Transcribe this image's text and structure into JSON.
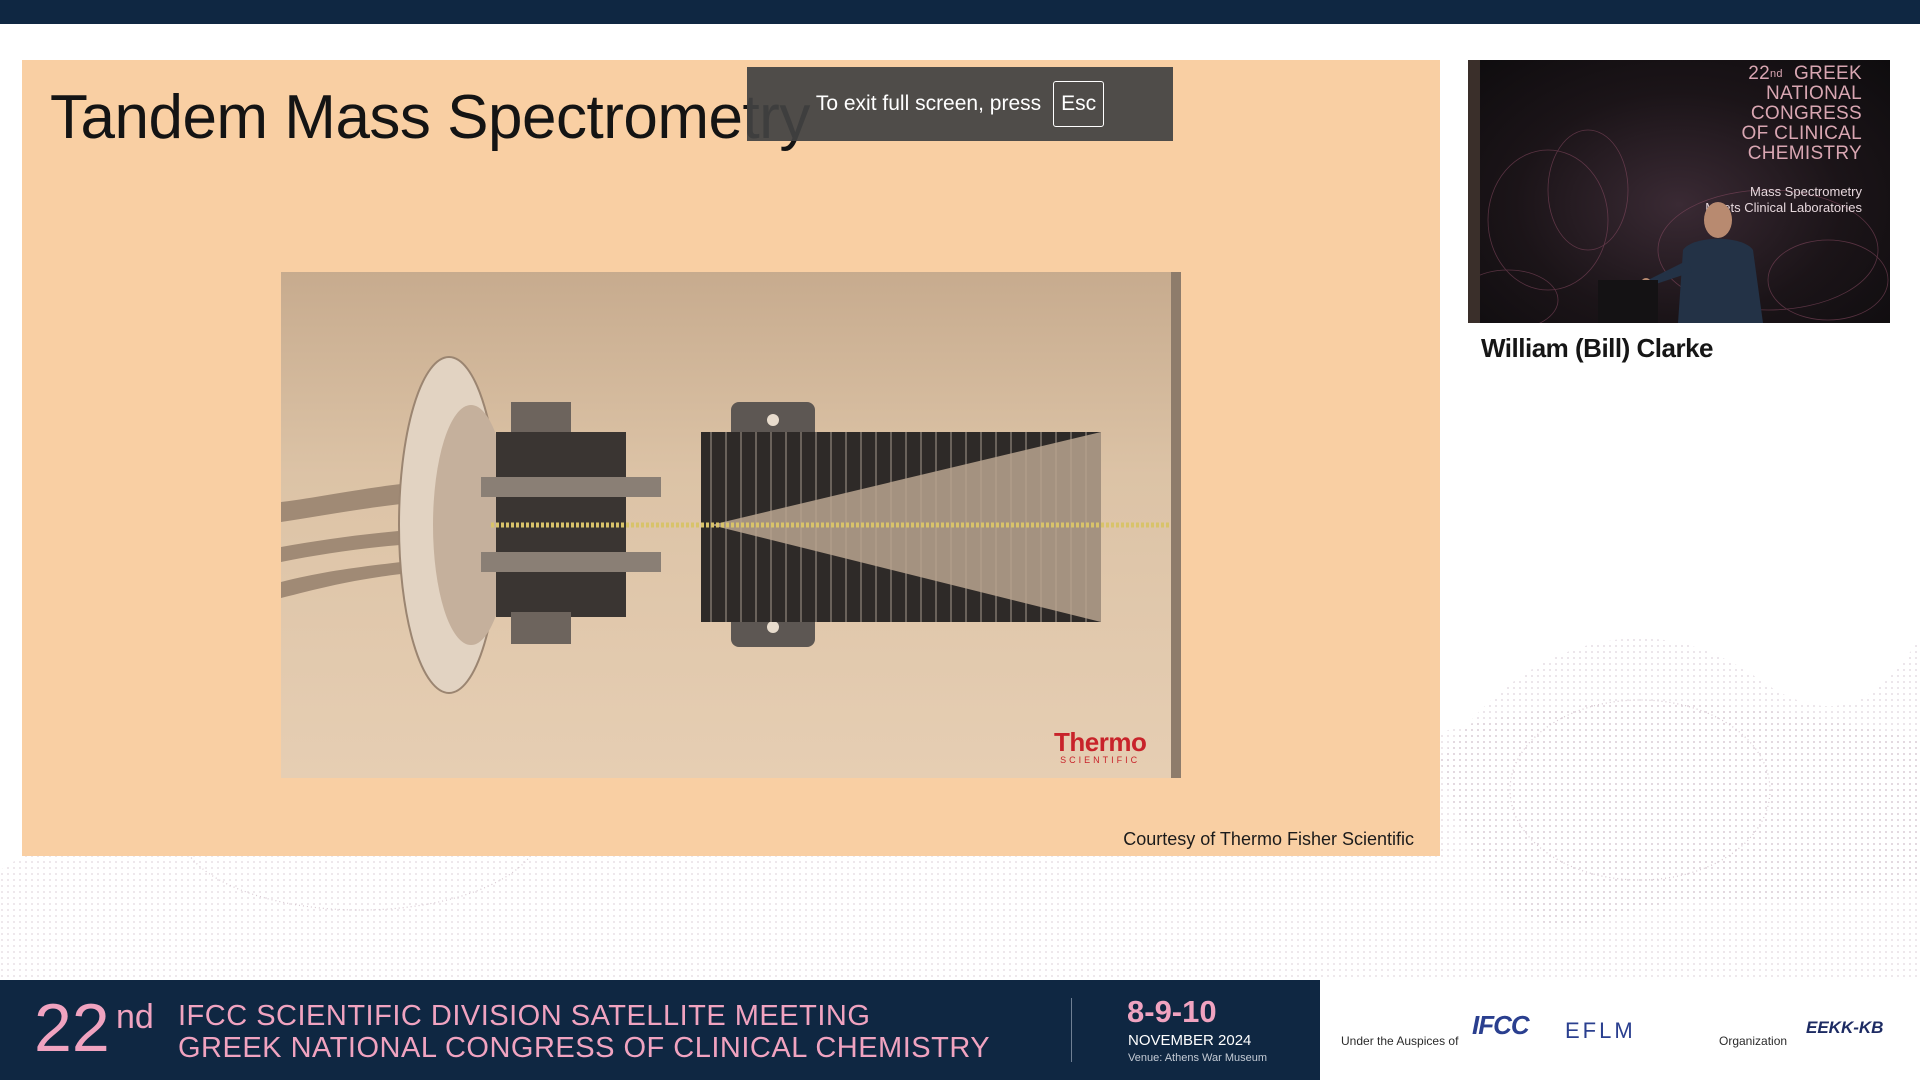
{
  "slide": {
    "title": "Tandem Mass Spectrometry",
    "logo_main": "Thermo",
    "logo_sub": "SCIENTIFIC",
    "credit": "Courtesy of Thermo Fisher Scientific"
  },
  "fullscreen_toast": {
    "text": "To exit full screen, press",
    "key": "Esc"
  },
  "video": {
    "brand_num": "22",
    "brand_sup": "nd",
    "brand_lines": [
      "GREEK",
      "NATIONAL",
      "CONGRESS",
      "OF CLINICAL",
      "CHEMISTRY"
    ],
    "subtitle_lines": [
      "Mass Spectrometry",
      "Meets Clinical Laboratories"
    ]
  },
  "speaker": {
    "name": "William (Bill) Clarke"
  },
  "banner": {
    "number": "22",
    "number_sup": "nd",
    "line1": "IFCC SCIENTIFIC DIVISION SATELLITE MEETING",
    "line2": "GREEK NATIONAL CONGRESS OF CLINICAL CHEMISTRY",
    "dates": "8-9-10",
    "month": "NOVEMBER 2024",
    "venue": "Venue: Athens War Museum"
  },
  "sponsors": {
    "auspices_label": "Under the Auspices of",
    "organization_label": "Organization",
    "logos": [
      "IFCC",
      "EFLM",
      "EEKK-KB"
    ]
  },
  "colors": {
    "banner_bg": "#0f2742",
    "banner_accent": "#f0a3c0",
    "slide_bg": "#f9cfa3",
    "logo_red": "#c8232a"
  }
}
